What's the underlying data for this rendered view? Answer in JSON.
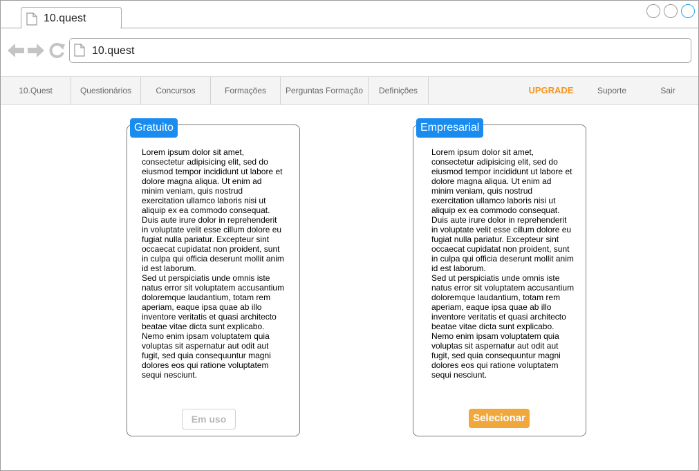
{
  "window": {
    "tab_title": "10.quest",
    "url": "10.quest"
  },
  "menu": {
    "items": [
      "10.Quest",
      "Questionários",
      "Concursos",
      "Formações",
      "Perguntas Formação",
      "Definições"
    ],
    "upgrade": "UPGRADE",
    "support": "Suporte",
    "logout": "Sair"
  },
  "plans": [
    {
      "name": "Gratuito",
      "description": "Lorem ipsum dolor sit amet,\nconsectetur adipisicing elit, sed do\neiusmod tempor incididunt ut labore et\ndolore magna aliqua. Ut enim ad\nminim veniam, quis nostrud\nexercitation ullamco laboris nisi ut\naliquip ex ea commodo consequat.\nDuis aute irure dolor in reprehenderit\nin voluptate velit esse cillum dolore eu\nfugiat nulla pariatur. Excepteur sint\noccaecat cupidatat non proident, sunt\nin culpa qui officia deserunt mollit anim\nid est laborum.\nSed ut perspiciatis unde omnis iste\nnatus error sit voluptatem accusantium\ndoloremque laudantium, totam rem\naperiam, eaque ipsa quae ab illo\ninventore veritatis et quasi architecto\nbeatae vitae dicta sunt explicabo.\nNemo enim ipsam voluptatem quia\nvoluptas sit aspernatur aut odit aut\nfugit, sed quia consequuntur magni\ndolores eos qui ratione voluptatem\nsequi nesciunt.",
      "button": "Em uso"
    },
    {
      "name": "Empresarial",
      "description": "Lorem ipsum dolor sit amet,\nconsectetur adipisicing elit, sed do\neiusmod tempor incididunt ut labore et\ndolore magna aliqua. Ut enim ad\nminim veniam, quis nostrud\nexercitation ullamco laboris nisi ut\naliquip ex ea commodo consequat.\nDuis aute irure dolor in reprehenderit\nin voluptate velit esse cillum dolore eu\nfugiat nulla pariatur. Excepteur sint\noccaecat cupidatat non proident, sunt\nin culpa qui officia deserunt mollit anim\nid est laborum.\nSed ut perspiciatis unde omnis iste\nnatus error sit voluptatem accusantium\ndoloremque laudantium, totam rem\naperiam, eaque ipsa quae ab illo\ninventore veritatis et quasi architecto\nbeatae vitae dicta sunt explicabo.\nNemo enim ipsam voluptatem quia\nvoluptas sit aspernatur aut odit aut\nfugit, sed quia consequuntur magni\ndolores eos qui ratione voluptatem\nsequi nesciunt.",
      "button": "Selecionar"
    }
  ],
  "icons": {
    "tab": "document-icon",
    "back": "back-arrow-icon",
    "forward": "forward-arrow-icon",
    "reload": "reload-icon",
    "url": "document-icon"
  },
  "colors": {
    "accent_blue": "#1a8cf0",
    "upgrade_orange": "#f7941e",
    "select_button": "#f0a83c",
    "window_active_circle": "#2ea7e8"
  }
}
